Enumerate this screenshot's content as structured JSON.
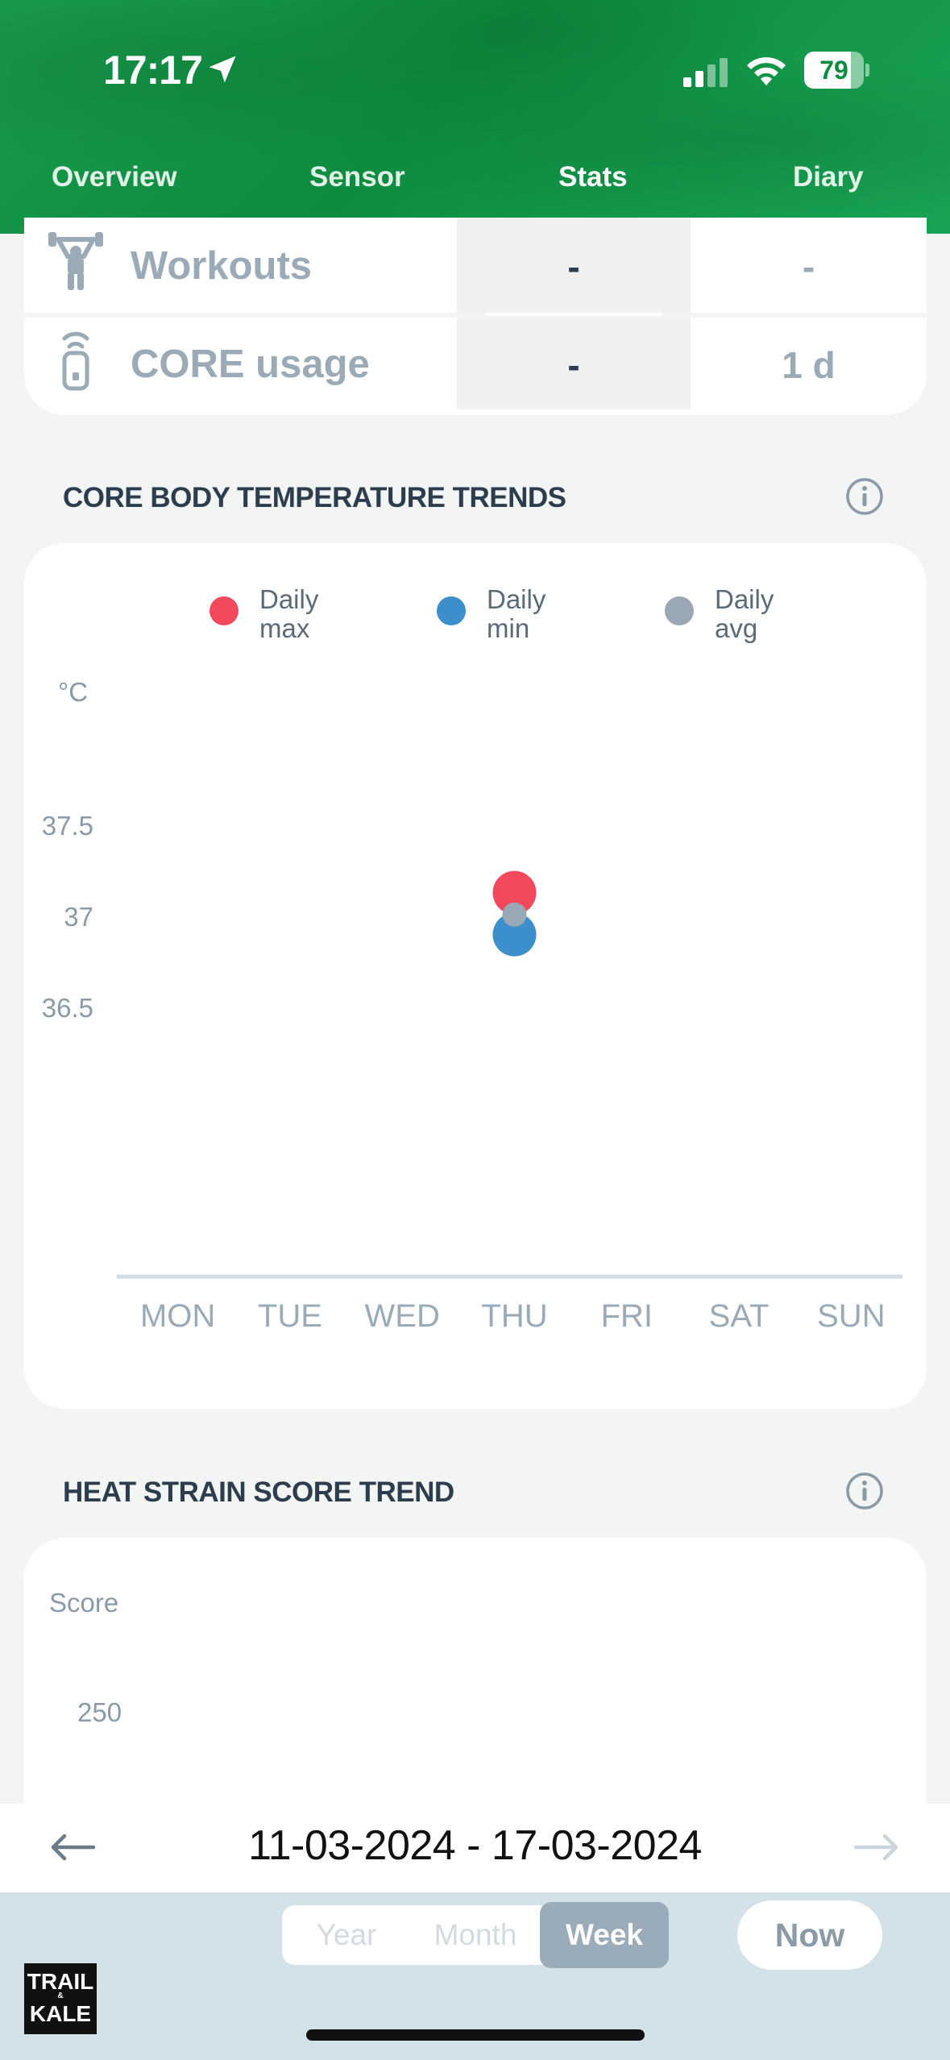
{
  "status_bar": {
    "time": "17:17",
    "battery": "79",
    "battery_level": 0.79
  },
  "tabs": [
    {
      "label": "Overview",
      "active": false
    },
    {
      "label": "Sensor",
      "active": false
    },
    {
      "label": "Stats",
      "active": true
    },
    {
      "label": "Diary",
      "active": false
    }
  ],
  "usage_table": {
    "rows": [
      {
        "label": "Workouts",
        "icon": "weightlifter-icon",
        "col1": "-",
        "col2": "-"
      },
      {
        "label": "CORE usage",
        "icon": "sensor-device-icon",
        "col1": "-",
        "col2": "1 d"
      }
    ]
  },
  "temperature_section": {
    "title": "CORE BODY TEMPERATURE TRENDS",
    "info_icon": "info-icon",
    "legend": [
      {
        "label": "Daily\nmax",
        "color": "#f2495c"
      },
      {
        "label": "Daily\nmin",
        "color": "#3d8fcc"
      },
      {
        "label": "Daily\navg",
        "color": "#9aa8b5"
      }
    ]
  },
  "chart_data": {
    "type": "scatter",
    "ylabel": "°C",
    "yticks": [
      "37.5",
      "37",
      "36.5"
    ],
    "ylim": [
      36.3,
      37.7
    ],
    "categories": [
      "MON",
      "TUE",
      "WED",
      "THU",
      "FRI",
      "SAT",
      "SUN"
    ],
    "series": [
      {
        "name": "Daily max",
        "color": "#f2495c",
        "values": [
          null,
          null,
          null,
          37.13,
          null,
          null,
          null
        ]
      },
      {
        "name": "Daily min",
        "color": "#3d8fcc",
        "values": [
          null,
          null,
          null,
          36.9,
          null,
          null,
          null
        ]
      },
      {
        "name": "Daily avg",
        "color": "#9aa8b5",
        "values": [
          null,
          null,
          null,
          37.01,
          null,
          null,
          null
        ]
      }
    ],
    "grid": false,
    "legend_position": "top"
  },
  "heat_section": {
    "title": "HEAT STRAIN SCORE TREND",
    "info_icon": "info-icon",
    "ylabel": "Score",
    "ytick_top": "250"
  },
  "date_range": {
    "text": "11-03-2024 - 17-03-2024",
    "prev_icon": "arrow-left-icon",
    "next_icon": "arrow-right-icon"
  },
  "period_selector": {
    "options": [
      {
        "label": "Year",
        "active": false
      },
      {
        "label": "Month",
        "active": false
      },
      {
        "label": "Week",
        "active": true
      }
    ],
    "now_label": "Now"
  },
  "logo": {
    "top": "TRAIL",
    "amp": "&",
    "bottom": "KALE"
  }
}
